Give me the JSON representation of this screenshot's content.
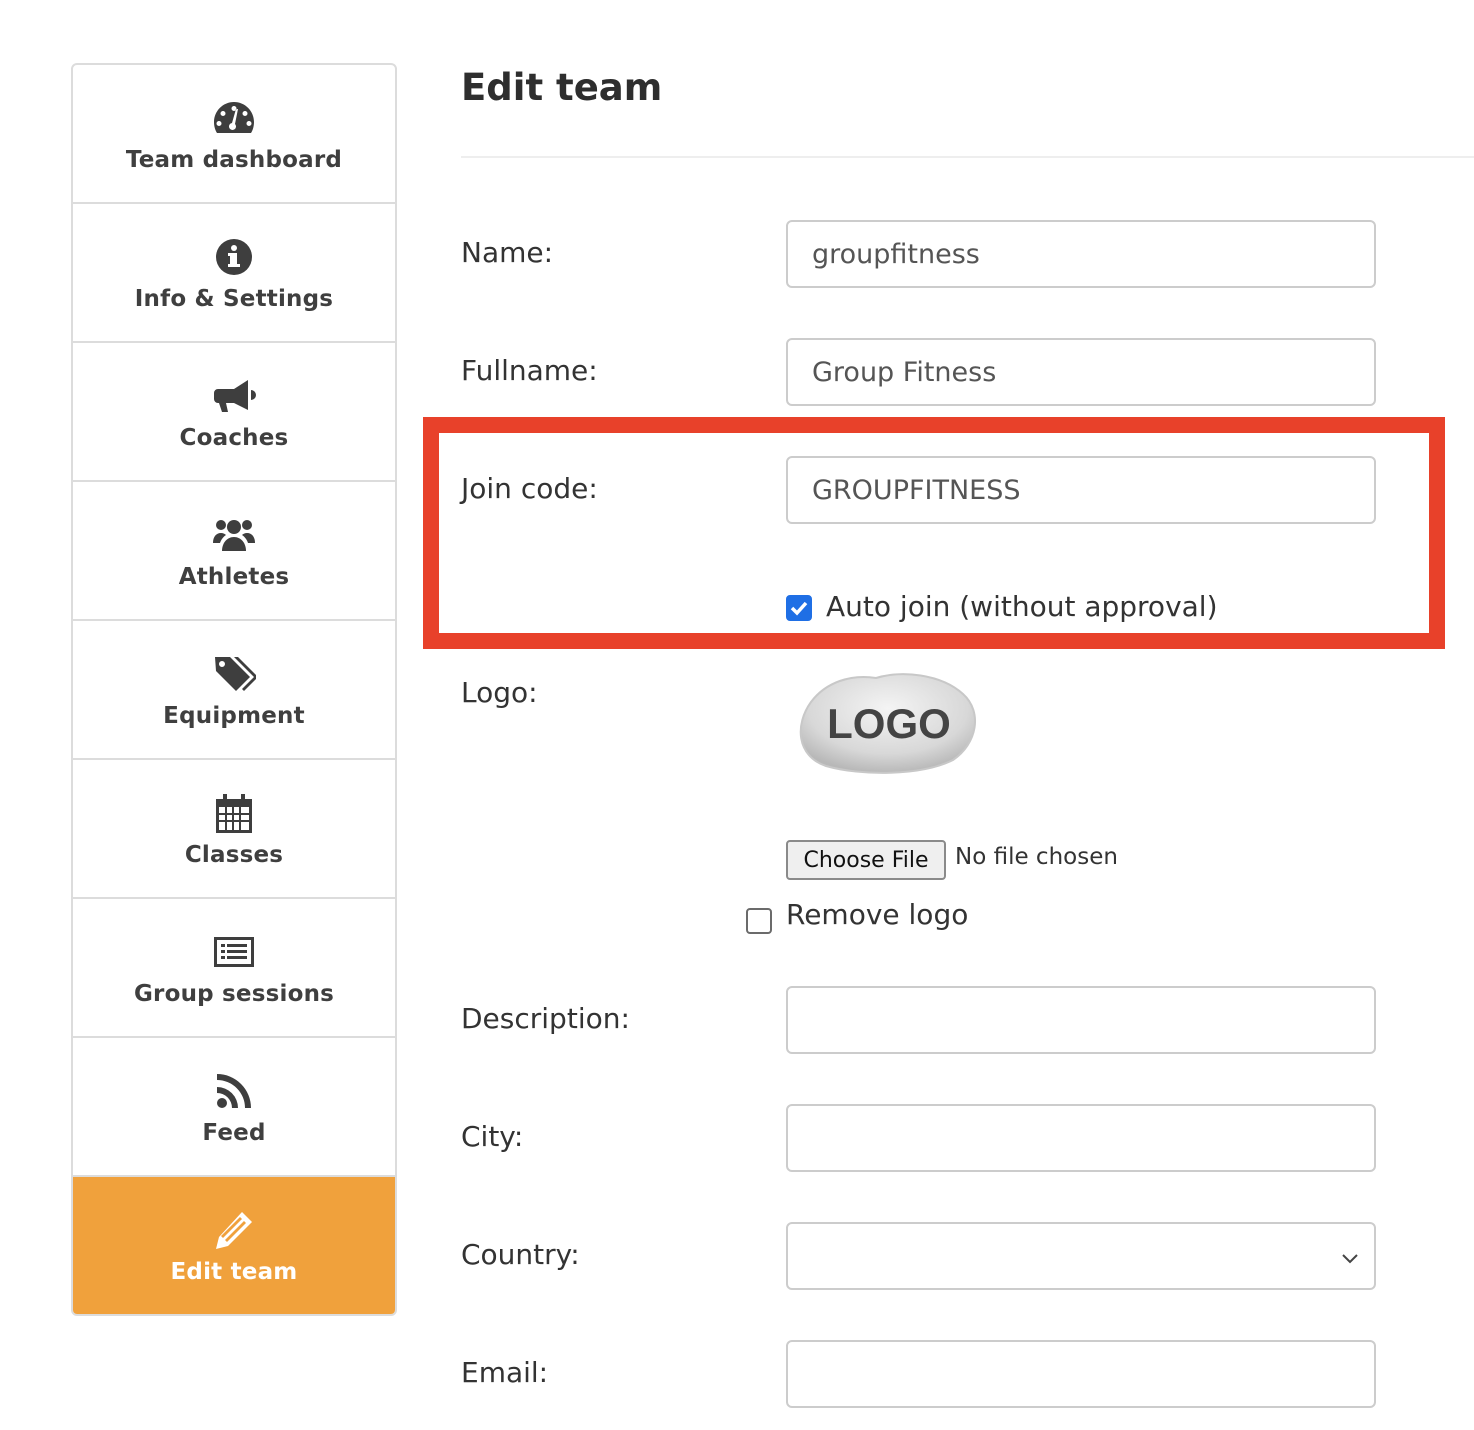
{
  "sidebar": {
    "items": [
      {
        "label": "Team dashboard",
        "icon": "dashboard-icon",
        "active": false
      },
      {
        "label": "Info & Settings",
        "icon": "info-icon",
        "active": false
      },
      {
        "label": "Coaches",
        "icon": "megaphone-icon",
        "active": false
      },
      {
        "label": "Athletes",
        "icon": "users-icon",
        "active": false
      },
      {
        "label": "Equipment",
        "icon": "tags-icon",
        "active": false
      },
      {
        "label": "Classes",
        "icon": "calendar-icon",
        "active": false
      },
      {
        "label": "Group sessions",
        "icon": "list-icon",
        "active": false
      },
      {
        "label": "Feed",
        "icon": "rss-icon",
        "active": false
      },
      {
        "label": "Edit team",
        "icon": "pencil-icon",
        "active": true
      }
    ],
    "active_color": "#f0a13c"
  },
  "main": {
    "title": "Edit team",
    "form": {
      "name_label": "Name:",
      "name_value": "groupfitness",
      "fullname_label": "Fullname:",
      "fullname_value": "Group Fitness",
      "join_code_label": "Join code:",
      "join_code_value": "GROUPFITNESS",
      "auto_join_label": "Auto join (without approval)",
      "auto_join_checked": true,
      "logo_label": "Logo:",
      "logo_text": "LOGO",
      "choose_file_label": "Choose File",
      "file_status": "No file chosen",
      "remove_logo_label": "Remove logo",
      "remove_logo_checked": false,
      "description_label": "Description:",
      "description_value": "",
      "city_label": "City:",
      "city_value": "",
      "country_label": "Country:",
      "country_value": "",
      "email_label": "Email:",
      "email_value": ""
    },
    "highlight_color": "#e8412a"
  }
}
